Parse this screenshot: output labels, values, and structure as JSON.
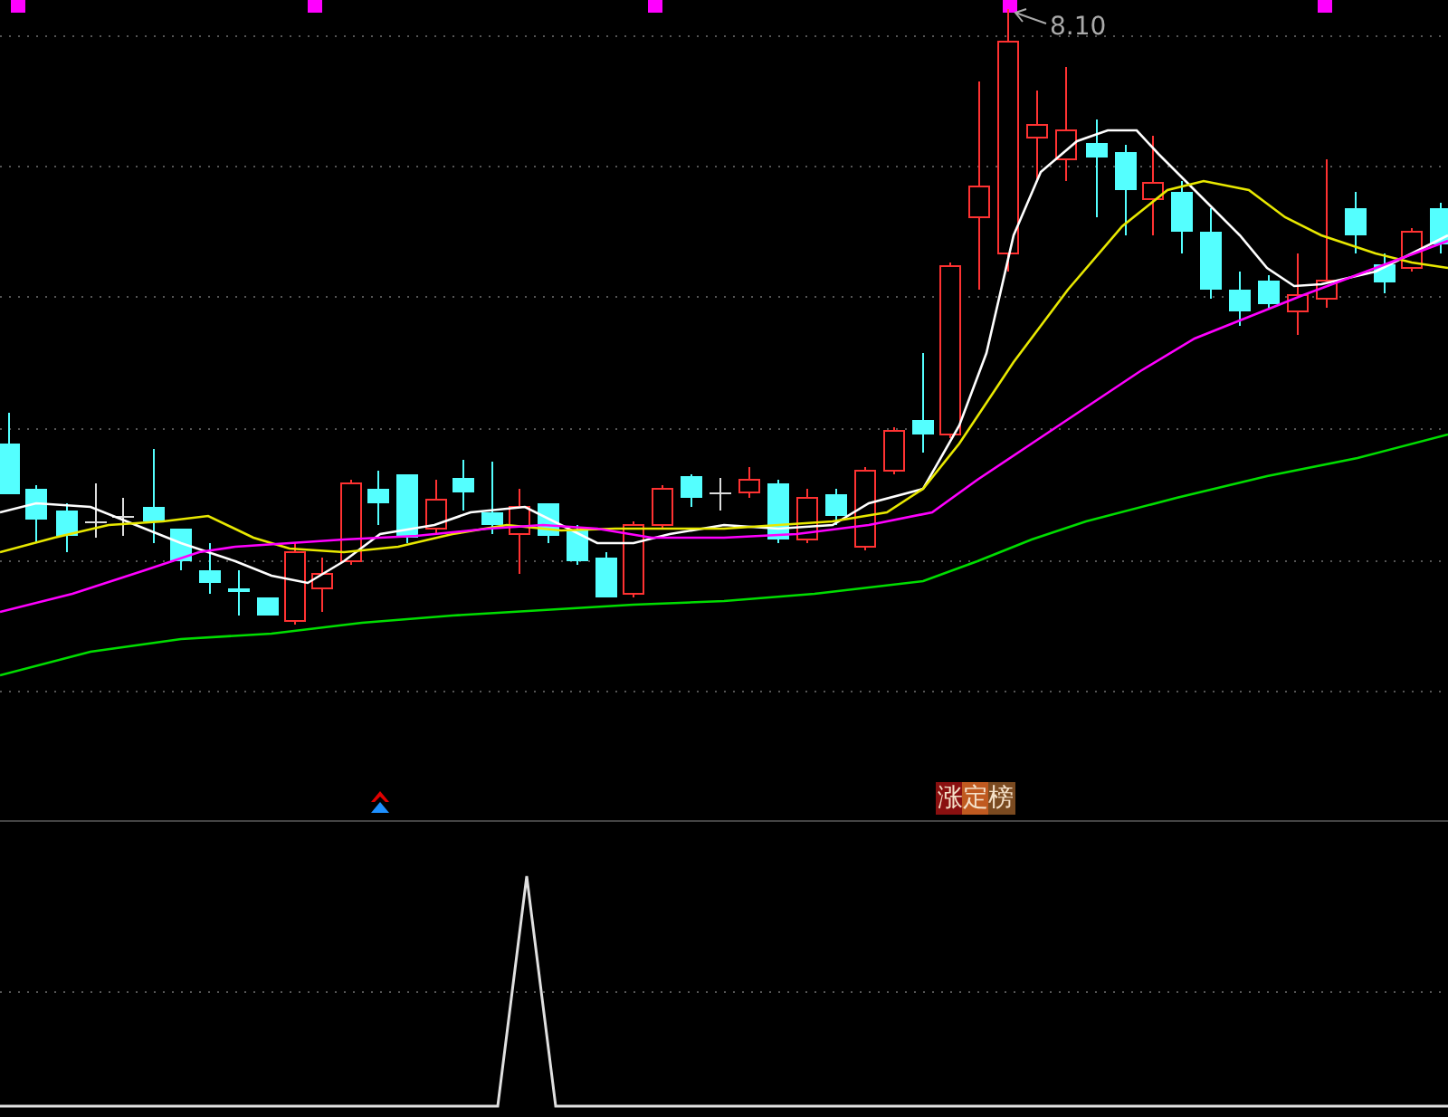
{
  "main_chart": {
    "high_label": "8.10",
    "signal_badge": "涨定榜"
  }
}
